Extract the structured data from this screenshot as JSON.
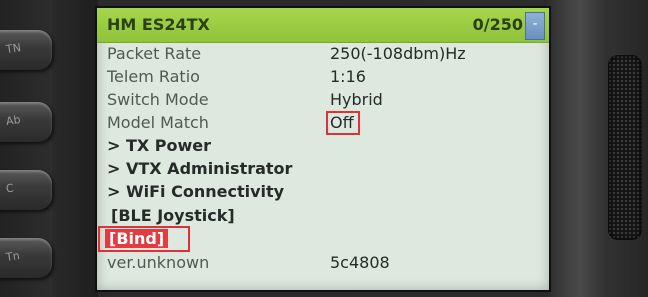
{
  "header": {
    "title": "HM ES24TX",
    "counter": "0/250",
    "dropdown_icon": "-"
  },
  "rows": [
    {
      "label": "Packet Rate",
      "value": "250(-108dbm)Hz"
    },
    {
      "label": "Telem Ratio",
      "value": "1:16"
    },
    {
      "label": "Switch Mode",
      "value": "Hybrid"
    },
    {
      "label": "Model Match",
      "value": "Off"
    }
  ],
  "folders": [
    "> TX Power",
    "> VTX Administrator",
    "> WiFi Connectivity"
  ],
  "commands": {
    "ble_joystick": "[BLE Joystick]",
    "bind": "[Bind]"
  },
  "version": {
    "label": "ver.unknown",
    "value": "5c4808"
  },
  "side_buttons": [
    "TN",
    "Ab",
    "C",
    "Tn"
  ],
  "colors": {
    "header_bg": "#9acd42",
    "screen_bg": "#dde9df",
    "highlight": "#e0303a",
    "selected_bg": "#e43a42"
  }
}
